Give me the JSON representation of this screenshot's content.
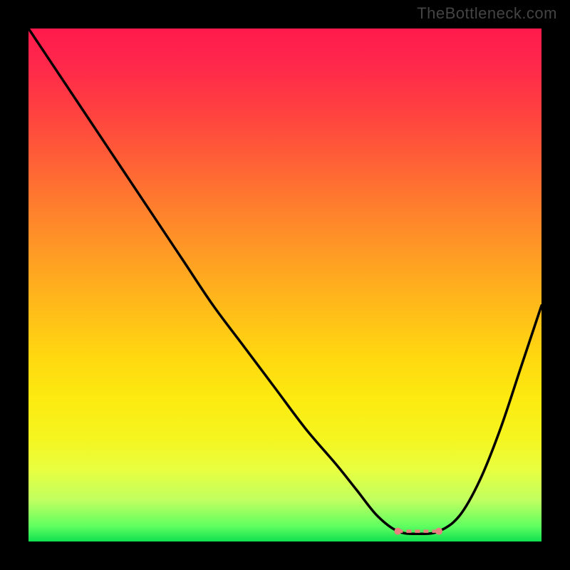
{
  "watermark": "TheBottleneck.com",
  "chart_data": {
    "type": "line",
    "title": "",
    "xlabel": "",
    "ylabel": "",
    "xlim": [
      0,
      100
    ],
    "ylim": [
      0,
      100
    ],
    "x": [
      0,
      6,
      12,
      18,
      24,
      30,
      36,
      42,
      48,
      54,
      60,
      64,
      68,
      72,
      76,
      80,
      84,
      88,
      92,
      96,
      100
    ],
    "values": [
      100,
      91,
      82,
      73,
      64,
      55,
      46,
      38,
      30,
      22,
      15,
      10,
      5,
      2,
      1.5,
      2,
      5,
      12,
      22,
      34,
      46
    ],
    "gradient_colors": {
      "top": "#ff1a4d",
      "mid": "#ffd810",
      "bottom": "#10e050"
    },
    "trough_marker_color": "#e88080",
    "curve_color": "#000000"
  }
}
